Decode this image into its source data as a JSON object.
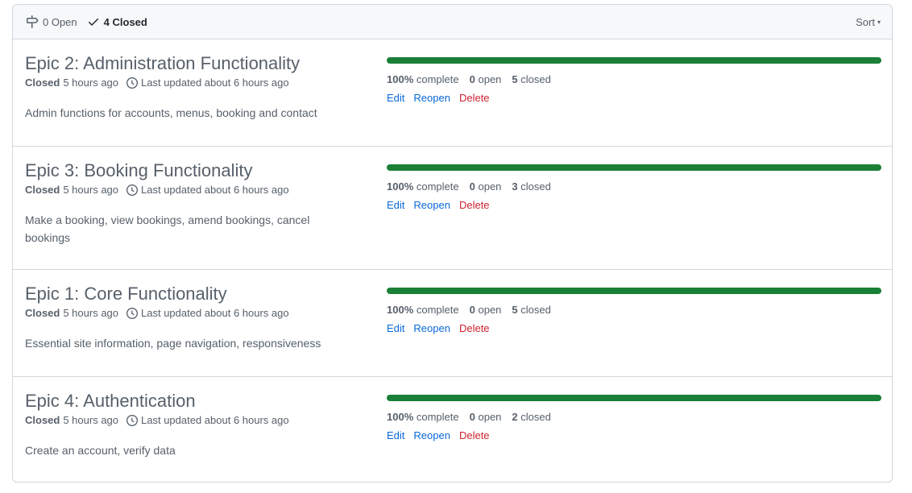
{
  "header": {
    "open_label": "0 Open",
    "closed_label": "4 Closed",
    "sort_label": "Sort"
  },
  "milestones": [
    {
      "title": "Epic 2: Administration Functionality",
      "status": "Closed",
      "closed_ago": "5 hours ago",
      "updated": "Last updated about 6 hours ago",
      "description": "Admin functions for accounts, menus, booking and contact",
      "progress_percent": 100,
      "complete_pct": "100%",
      "complete_label": "complete",
      "open_count": "0",
      "open_label": "open",
      "closed_count": "5",
      "closed_label": "closed",
      "edit": "Edit",
      "reopen": "Reopen",
      "delete": "Delete"
    },
    {
      "title": "Epic 3: Booking Functionality",
      "status": "Closed",
      "closed_ago": "5 hours ago",
      "updated": "Last updated about 6 hours ago",
      "description": "Make a booking, view bookings, amend bookings, cancel bookings",
      "progress_percent": 100,
      "complete_pct": "100%",
      "complete_label": "complete",
      "open_count": "0",
      "open_label": "open",
      "closed_count": "3",
      "closed_label": "closed",
      "edit": "Edit",
      "reopen": "Reopen",
      "delete": "Delete"
    },
    {
      "title": "Epic 1: Core Functionality",
      "status": "Closed",
      "closed_ago": "5 hours ago",
      "updated": "Last updated about 6 hours ago",
      "description": "Essential site information, page navigation, responsiveness",
      "progress_percent": 100,
      "complete_pct": "100%",
      "complete_label": "complete",
      "open_count": "0",
      "open_label": "open",
      "closed_count": "5",
      "closed_label": "closed",
      "edit": "Edit",
      "reopen": "Reopen",
      "delete": "Delete"
    },
    {
      "title": "Epic 4: Authentication",
      "status": "Closed",
      "closed_ago": "5 hours ago",
      "updated": "Last updated about 6 hours ago",
      "description": "Create an account, verify data",
      "progress_percent": 100,
      "complete_pct": "100%",
      "complete_label": "complete",
      "open_count": "0",
      "open_label": "open",
      "closed_count": "2",
      "closed_label": "closed",
      "edit": "Edit",
      "reopen": "Reopen",
      "delete": "Delete"
    }
  ],
  "colors": {
    "progress_fill": "#1a7f37",
    "link": "#0969da",
    "danger": "#cf222e"
  },
  "icons": {
    "open": "milestone-icon",
    "closed": "check-icon",
    "updated": "clock-icon"
  }
}
